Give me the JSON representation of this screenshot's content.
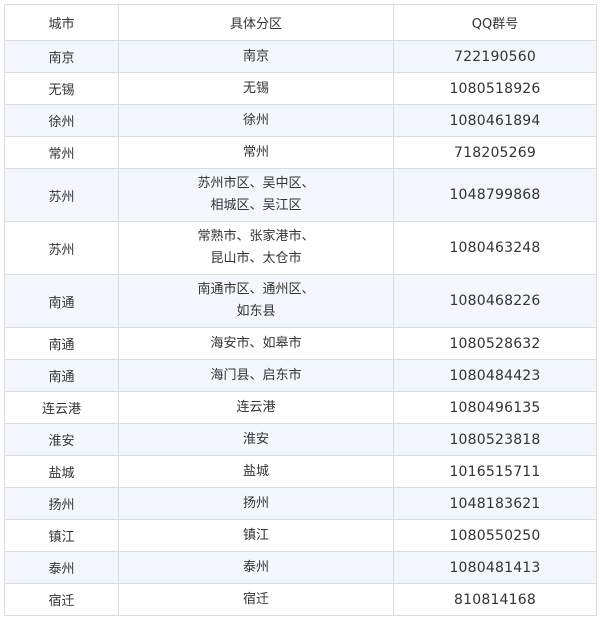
{
  "table": {
    "headers": [
      "城市",
      "具体分区",
      "QQ群号"
    ],
    "rows": [
      {
        "city": "南京",
        "district": [
          "南京"
        ],
        "qq": "722190560"
      },
      {
        "city": "无锡",
        "district": [
          "无锡"
        ],
        "qq": "1080518926"
      },
      {
        "city": "徐州",
        "district": [
          "徐州"
        ],
        "qq": "1080461894"
      },
      {
        "city": "常州",
        "district": [
          "常州"
        ],
        "qq": "718205269"
      },
      {
        "city": "苏州",
        "district": [
          "苏州市区、吴中区、",
          "相城区、吴江区"
        ],
        "qq": "1048799868"
      },
      {
        "city": "苏州",
        "district": [
          "常熟市、张家港市、",
          "昆山市、太仓市"
        ],
        "qq": "1080463248"
      },
      {
        "city": "南通",
        "district": [
          "南通市区、通州区、",
          "如东县"
        ],
        "qq": "1080468226"
      },
      {
        "city": "南通",
        "district": [
          "海安市、如皋市"
        ],
        "qq": "1080528632"
      },
      {
        "city": "南通",
        "district": [
          "海门县、启东市"
        ],
        "qq": "1080484423"
      },
      {
        "city": "连云港",
        "district": [
          "连云港"
        ],
        "qq": "1080496135"
      },
      {
        "city": "淮安",
        "district": [
          "淮安"
        ],
        "qq": "1080523818"
      },
      {
        "city": "盐城",
        "district": [
          "盐城"
        ],
        "qq": "1016515711"
      },
      {
        "city": "扬州",
        "district": [
          "扬州"
        ],
        "qq": "1048183621"
      },
      {
        "city": "镇江",
        "district": [
          "镇江"
        ],
        "qq": "1080550250"
      },
      {
        "city": "泰州",
        "district": [
          "泰州"
        ],
        "qq": "1080481413"
      },
      {
        "city": "宿迁",
        "district": [
          "宿迁"
        ],
        "qq": "810814168"
      }
    ]
  }
}
